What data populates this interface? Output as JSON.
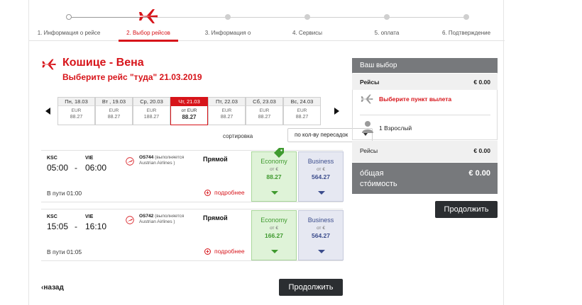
{
  "steps": [
    {
      "label": "1. Информация о рейсе",
      "state": "done"
    },
    {
      "label": "2. Выбор рейсов",
      "state": "active"
    },
    {
      "label": "3. Информация о",
      "state": "todo"
    },
    {
      "label": "4. Сервисы",
      "state": "todo"
    },
    {
      "label": "5. оплата",
      "state": "todo"
    },
    {
      "label": "6. Подтверждение",
      "state": "todo"
    }
  ],
  "route": {
    "title": "Кошице - Вена",
    "subtitle": "Выберите рейс \"туда\" 21.03.2019"
  },
  "days": [
    {
      "name": "Пн, 18.03",
      "cur": "EUR",
      "price": "88.27"
    },
    {
      "name": "Вт , 19.03",
      "cur": "EUR",
      "price": "88.27"
    },
    {
      "name": "Ср, 20.03",
      "cur": "EUR",
      "price": "188.27"
    },
    {
      "name": "Чт, 21.03",
      "cur": "от EUR",
      "price": "88.27",
      "selected": true
    },
    {
      "name": "Пт, 22.03",
      "cur": "EUR",
      "price": "88.27"
    },
    {
      "name": "Сб, 23.03",
      "cur": "EUR",
      "price": "88.27"
    },
    {
      "name": "Вс, 24.03",
      "cur": "EUR",
      "price": "88.27"
    }
  ],
  "sort": {
    "label": "сортировка",
    "value": "по кол-ву пересадок"
  },
  "flights": [
    {
      "dep_code": "KSC",
      "arr_code": "VIE",
      "dep_time": "05:00",
      "dash": "-",
      "arr_time": "06:00",
      "flight_no": "OS744",
      "operated": "(выполняется",
      "airline": "Austrian Airlines )",
      "stops": "Прямой",
      "duration": "В пути 01:00",
      "more": "подробнее",
      "economy": {
        "cls": "Economy",
        "from": "от €",
        "amount": "88.27"
      },
      "business": {
        "cls": "Business",
        "from": "от €",
        "amount": "564.27"
      }
    },
    {
      "dep_code": "KSC",
      "arr_code": "VIE",
      "dep_time": "15:05",
      "dash": "-",
      "arr_time": "16:10",
      "flight_no": "OS742",
      "operated": "(выполняется",
      "airline": "Austrian Airlines )",
      "stops": "Прямой",
      "duration": "В пути 01:05",
      "more": "подробнее",
      "economy": {
        "cls": "Economy",
        "from": "от €",
        "amount": "166.27"
      },
      "business": {
        "cls": "Business",
        "from": "от €",
        "amount": "564.27"
      }
    }
  ],
  "nav": {
    "back": "назад",
    "continue": "Продолжить"
  },
  "sidebar": {
    "header": "Ваш выбор",
    "flights_label": "Рейсы",
    "flights_price": "€ 0.00",
    "pick_departure": "Выберите пункт вылета",
    "passengers": "1 Взрослый",
    "flights_label2": "Рейсы",
    "flights_price2": "€ 0.00",
    "total_label": "о́бщая сто́имость",
    "total_price": "€ 0.00",
    "continue": "Продолжить"
  },
  "colors": {
    "accent": "#d7141a",
    "economy": "#3f9a2f",
    "business": "#3b4c8c",
    "dark": "#2b2e31"
  }
}
